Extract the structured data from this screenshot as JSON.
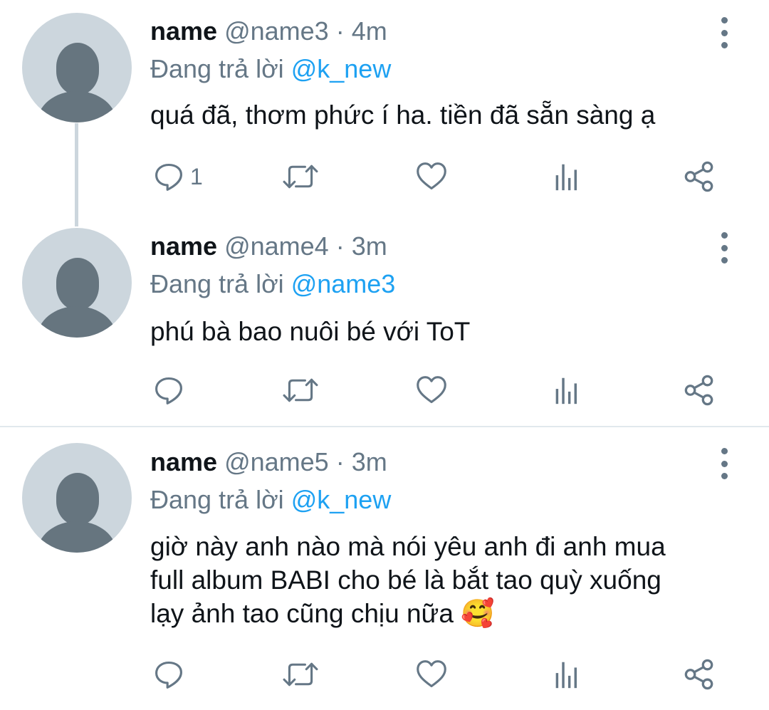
{
  "replying_prefix": "Đang trả lời",
  "colors": {
    "accent": "#1da1f2",
    "muted": "#657786",
    "avatar_bg": "#ccd6dd",
    "avatar_fg": "#66757f"
  },
  "icons": [
    "more-vertical-icon",
    "reply-icon",
    "retweet-icon",
    "like-icon",
    "analytics-icon",
    "share-icon",
    "avatar-placeholder-icon"
  ],
  "tweets": [
    {
      "display_name": "name",
      "handle": "@name3",
      "separator": "·",
      "time": "4m",
      "replying_to": "@k_new",
      "text": "quá đã, thơm phức í ha. tiền đã sẵn sàng ạ",
      "reply_count": "1"
    },
    {
      "display_name": "name",
      "handle": "@name4",
      "separator": "·",
      "time": "3m",
      "replying_to": "@name3",
      "text": "phú bà bao nuôi bé với ToT",
      "reply_count": ""
    },
    {
      "display_name": "name",
      "handle": "@name5",
      "separator": "·",
      "time": "3m",
      "replying_to": "@k_new",
      "text_lines": [
        "giờ này anh nào mà nói yêu anh đi anh mua",
        "full album BABI cho bé là bắt tao quỳ xuống",
        "lạy ảnh tao cũng chịu nữa"
      ],
      "emoji": "🥰",
      "reply_count": ""
    }
  ]
}
